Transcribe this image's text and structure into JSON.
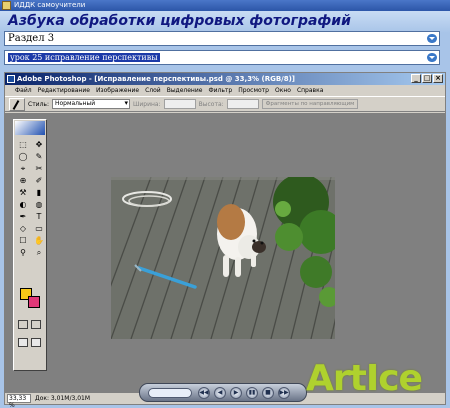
{
  "window": {
    "title": "ИДДК самоучители"
  },
  "banner": {
    "title": "Азбука обработки цифровых фотографий"
  },
  "section_select": {
    "value": "Раздел 3"
  },
  "lesson_select": {
    "value": "урок 25 исправление перспективы"
  },
  "photoshop": {
    "title": "Adobe Photoshop - [Исправление перспективы.psd @ 33,3% (RGB/8)]",
    "window_buttons": {
      "minimize": "_",
      "maximize": "□",
      "close": "×"
    },
    "menu": [
      "Файл",
      "Редактирование",
      "Изображение",
      "Слой",
      "Выделение",
      "Фильтр",
      "Просмотр",
      "Окно",
      "Справка"
    ],
    "options": {
      "style_label": "Стиль:",
      "style_value": "Нормальный",
      "width_label": "Ширина:",
      "height_label": "Высота:",
      "refine_button": "Фрагменты по направляющим"
    },
    "status": {
      "zoom": "33,33 %",
      "doc": "Док: 3,01М/3,01М"
    }
  },
  "tools": {
    "glyphs": [
      "⬚",
      "✥",
      "◯",
      "✎",
      "⌖",
      "✂",
      "⊕",
      "✐",
      "⚒",
      "▮",
      "◐",
      "◍",
      "✒",
      "T",
      "◇",
      "▭",
      "☐",
      "✋",
      "⚲",
      "⌕"
    ]
  },
  "colors": {
    "foreground": "#f8c818",
    "background": "#e03878",
    "title_bar": "#0a246a"
  },
  "player": {
    "buttons": [
      "◀◀",
      "◀",
      "▶",
      "▮▮",
      "■",
      "▶▶"
    ]
  },
  "watermark": {
    "text": "ArtIce"
  }
}
